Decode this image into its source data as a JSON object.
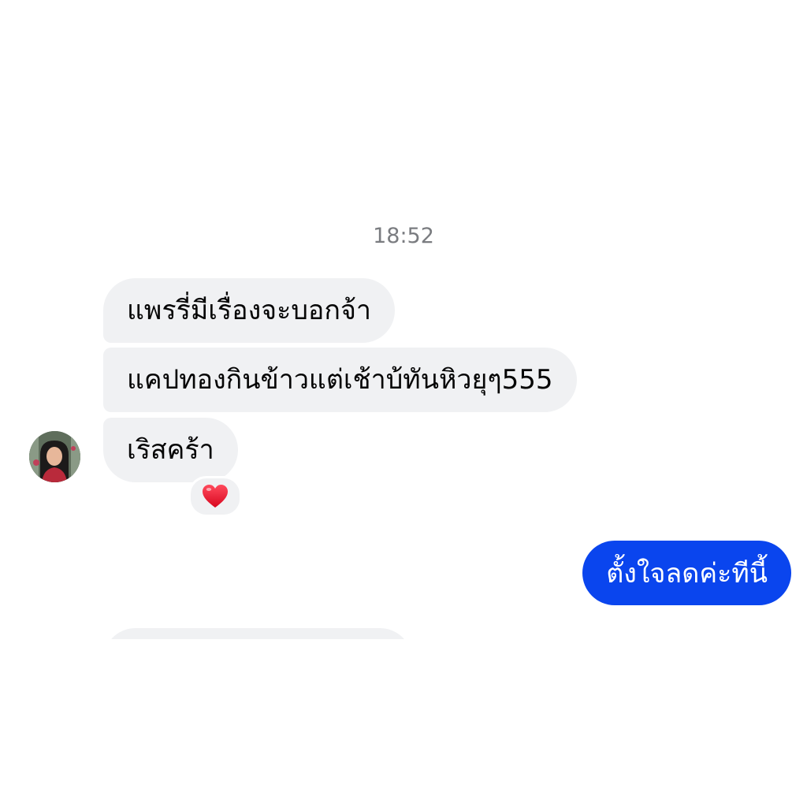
{
  "conversation": {
    "timestamp": "18:52",
    "received": [
      {
        "text": "แพรรี่มีเรื่องจะบอกจ้า"
      },
      {
        "text": "แคปทองกินข้าวแต่เช้าบ้ทันหิวยุๆ555"
      },
      {
        "text": "เริสคร้า"
      }
    ],
    "reaction": {
      "icon": "heart-icon",
      "emoji": "❤️",
      "color": "#e8112d"
    },
    "sent": [
      {
        "text": "ตั้งใจลดค่ะทีนี้"
      }
    ]
  },
  "colors": {
    "received_bubble": "#f0f1f3",
    "sent_bubble": "#0a45ee",
    "timestamp": "#7a7c80"
  }
}
